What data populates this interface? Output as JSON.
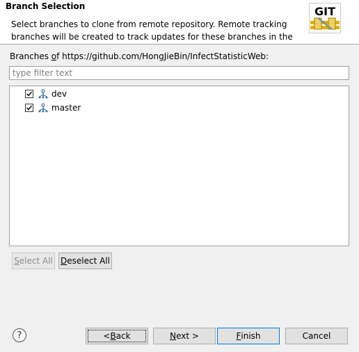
{
  "header": {
    "title": "Branch Selection",
    "description_line1": "Select branches to clone from remote repository. Remote tracking",
    "description_line2": "branches will be created to track updates for these branches in the",
    "logo_text": "GIT"
  },
  "branches_label": {
    "prefix": "Branches ",
    "mnemonic": "o",
    "suffix": "f https://github.com/HongJieBin/InfectStatisticWeb:"
  },
  "filter": {
    "placeholder": "type filter text",
    "value": ""
  },
  "branches": [
    {
      "name": "dev",
      "checked": true
    },
    {
      "name": "master",
      "checked": true
    }
  ],
  "buttons": {
    "select_all": {
      "mnemonic": "S",
      "rest": "elect All"
    },
    "deselect_all": {
      "mnemonic": "D",
      "rest": "eselect All"
    },
    "back": {
      "prefix": "< ",
      "mnemonic": "B",
      "rest": "ack"
    },
    "next": {
      "mnemonic": "N",
      "rest": "ext >"
    },
    "finish": {
      "mnemonic": "F",
      "rest": "inish"
    },
    "cancel": "Cancel"
  },
  "help_glyph": "?",
  "colors": {
    "focus_border": "#0078d7",
    "git_text": "#c00000",
    "branch_icon": "#3a6ea5"
  }
}
